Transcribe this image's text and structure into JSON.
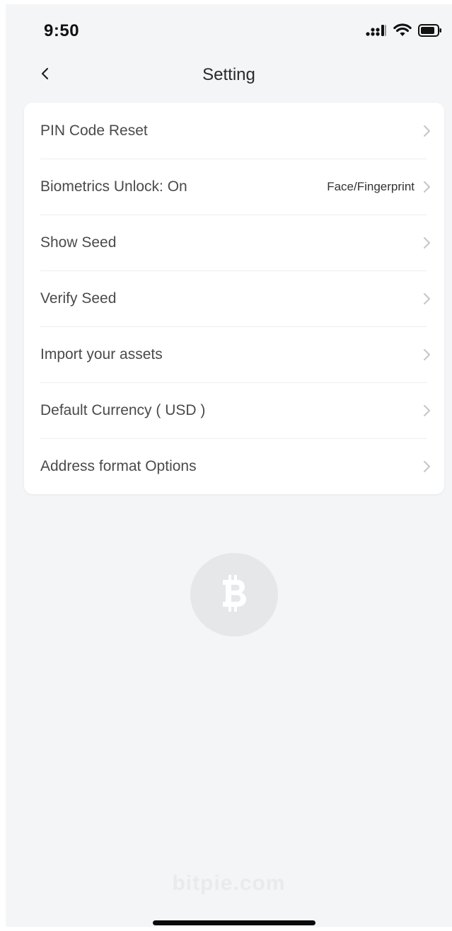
{
  "status_bar": {
    "time": "9:50",
    "icons": [
      "cellular-signal-icon",
      "wifi-icon",
      "battery-icon"
    ]
  },
  "nav": {
    "back_icon": "chevron-left-icon",
    "title": "Setting"
  },
  "settings": {
    "items": [
      {
        "label": "PIN Code Reset",
        "value": ""
      },
      {
        "label": "Biometrics Unlock: On",
        "value": "Face/Fingerprint"
      },
      {
        "label": "Show Seed",
        "value": ""
      },
      {
        "label": "Verify Seed",
        "value": ""
      },
      {
        "label": "Import your assets",
        "value": ""
      },
      {
        "label": "Default Currency ( USD )",
        "value": ""
      },
      {
        "label": "Address format Options",
        "value": ""
      }
    ]
  },
  "watermark": {
    "coin_icon": "bitcoin-icon",
    "text": "bitpie.com"
  },
  "colors": {
    "background": "#f4f5f7",
    "card": "#ffffff",
    "text_primary": "#4a4a4a",
    "chevron": "#c4c6ca",
    "coin_circle": "#e6e7e9"
  }
}
